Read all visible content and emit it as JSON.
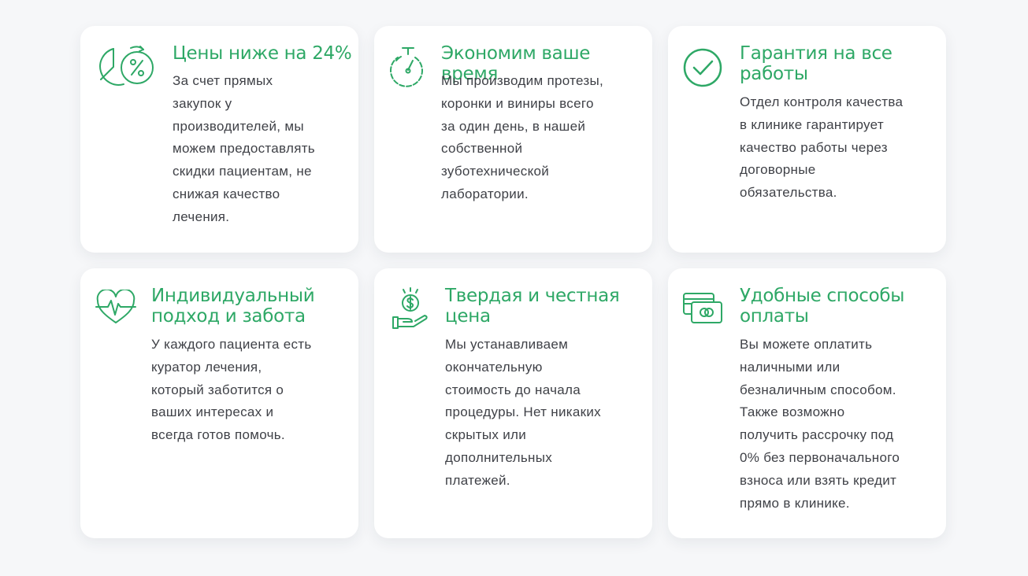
{
  "cards": [
    {
      "title_lines": [
        "Цены ниже на 24%"
      ],
      "text_lines": [
        "За счет прямых",
        "закупок у",
        "производителей, мы",
        "можем предоставлять",
        "скидки пациентам, не",
        "снижая качество",
        "лечения."
      ],
      "icon": "discount-percent-icon"
    },
    {
      "title_lines": [
        "Экономим ваше время"
      ],
      "text_lines": [
        "Мы производим протезы,",
        "коронки и виниры всего",
        "за один день, в нашей",
        "собственной",
        "зуботехнической",
        "лаборатории."
      ],
      "icon": "stopwatch-icon"
    },
    {
      "title_lines": [
        "Гарантия на все",
        "работы"
      ],
      "text_lines": [
        "Отдел контроля качества",
        "в клинике гарантирует",
        "качество работы через",
        "договорные",
        "обязательства."
      ],
      "icon": "check-circle-icon"
    },
    {
      "title_lines": [
        "Индивидуальный",
        "подход и забота"
      ],
      "text_lines": [
        "У каждого пациента есть",
        "куратор лечения,",
        "который заботится о",
        "ваших интересах и",
        "всегда готов помочь."
      ],
      "icon": "heart-pulse-icon"
    },
    {
      "title_lines": [
        "Твердая и честная",
        "цена"
      ],
      "text_lines": [
        "Мы устанавливаем",
        "окончательную",
        "стоимость до начала",
        "процедуры. Нет никаких",
        "скрытых или",
        "дополнительных",
        "платежей."
      ],
      "icon": "hand-dollar-icon"
    },
    {
      "title_lines": [
        "Удобные способы",
        "оплаты"
      ],
      "text_lines": [
        "Вы можете оплатить",
        "наличными или",
        "безналичным способом.",
        "Также возможно",
        "получить рассрочку под",
        "0% без первоначального",
        "взноса или взять кредит",
        "прямо в клинике."
      ],
      "icon": "payment-cards-icon"
    }
  ],
  "colors": {
    "accent": "#2ea866",
    "text": "#3f4147",
    "card": "#ffffff",
    "background": "#f6f7f9"
  }
}
